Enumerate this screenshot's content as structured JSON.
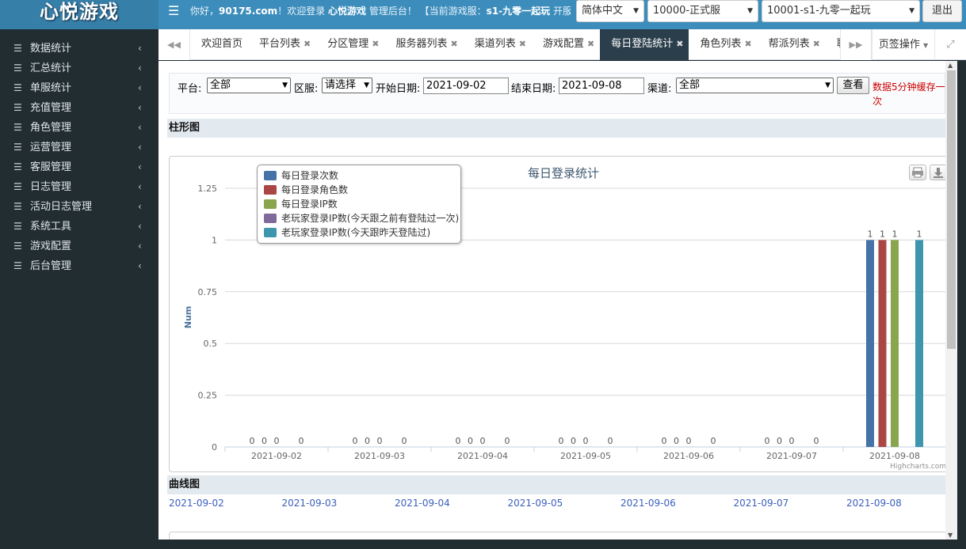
{
  "header": {
    "logo": "心悦游戏",
    "welcome_prefix": "你好，",
    "welcome_site": "90175.com",
    "welcome_middle": "！欢迎登录 ",
    "welcome_brand": "心悦游戏",
    "welcome_suffix": " 管理后台！ 【当前游戏服：",
    "current_server": "s1-九零一起玩",
    "welcome_tail": " 开服时间",
    "language": "简体中文",
    "server_group": "10000-正式服",
    "game_server": "10001-s1-九零一起玩",
    "logout": "退出"
  },
  "sidebar": {
    "items": [
      {
        "label": "数据统计",
        "icon": "menu-lines-icon"
      },
      {
        "label": "汇总统计",
        "icon": "menu-lines-icon"
      },
      {
        "label": "单服统计",
        "icon": "menu-lines-icon"
      },
      {
        "label": "充值管理",
        "icon": "menu-lines-icon"
      },
      {
        "label": "角色管理",
        "icon": "menu-lines-icon"
      },
      {
        "label": "运营管理",
        "icon": "menu-lines-icon"
      },
      {
        "label": "客服管理",
        "icon": "menu-lines-icon"
      },
      {
        "label": "日志管理",
        "icon": "menu-lines-icon"
      },
      {
        "label": "活动日志管理",
        "icon": "menu-lines-icon"
      },
      {
        "label": "系统工具",
        "icon": "menu-lines-icon"
      },
      {
        "label": "游戏配置",
        "icon": "menu-lines-icon"
      },
      {
        "label": "后台管理",
        "icon": "menu-lines-icon"
      }
    ]
  },
  "tabs": {
    "items": [
      {
        "label": "欢迎首页",
        "closable": false,
        "active": false
      },
      {
        "label": "平台列表",
        "closable": true,
        "active": false
      },
      {
        "label": "分区管理",
        "closable": true,
        "active": false
      },
      {
        "label": "服务器列表",
        "closable": true,
        "active": false
      },
      {
        "label": "渠道列表",
        "closable": true,
        "active": false
      },
      {
        "label": "游戏配置",
        "closable": true,
        "active": false
      },
      {
        "label": "每日登陆统计",
        "closable": true,
        "active": true
      },
      {
        "label": "角色列表",
        "closable": true,
        "active": false
      },
      {
        "label": "帮派列表",
        "closable": true,
        "active": false
      },
      {
        "label": "聊天",
        "closable": false,
        "active": false
      }
    ],
    "operations": "页签操作"
  },
  "filters": {
    "platform_label": "平台:",
    "platform_value": "全部",
    "zone_label": "区服:",
    "zone_value": "请选择",
    "start_label": "开始日期:",
    "start_value": "2021-09-02",
    "end_label": "结束日期:",
    "end_value": "2021-09-08",
    "channel_label": "渠道:",
    "channel_value": "全部",
    "query": "查看",
    "cache_note": "数据5分钟缓存一次"
  },
  "sections": {
    "bar": "柱形图",
    "line": "曲线图"
  },
  "chart_data": {
    "type": "bar",
    "title": "每日登录统计",
    "ylabel": "Num",
    "xlabel": "",
    "ylim": [
      0,
      1.25
    ],
    "yticks": [
      0,
      0.25,
      0.5,
      0.75,
      1,
      1.25
    ],
    "credits": "Highcharts.com",
    "legend_position": "top-left",
    "categories": [
      "2021-09-02",
      "2021-09-03",
      "2021-09-04",
      "2021-09-05",
      "2021-09-06",
      "2021-09-07",
      "2021-09-08"
    ],
    "series": [
      {
        "name": "每日登录次数",
        "color": "#4572a7",
        "values": [
          0,
          0,
          0,
          0,
          0,
          0,
          1
        ]
      },
      {
        "name": "每日登录角色数",
        "color": "#aa4643",
        "values": [
          0,
          0,
          0,
          0,
          0,
          0,
          1
        ]
      },
      {
        "name": "每日登录IP数",
        "color": "#89a54e",
        "values": [
          0,
          0,
          0,
          0,
          0,
          0,
          1
        ]
      },
      {
        "name": "老玩家登录IP数(今天跟之前有登陆过一次)",
        "color": "#80699b",
        "values": [
          null,
          null,
          null,
          null,
          null,
          null,
          null
        ]
      },
      {
        "name": "老玩家登录IP数(今天跟昨天登陆过)",
        "color": "#3d96ae",
        "values": [
          0,
          0,
          0,
          0,
          0,
          0,
          1
        ]
      }
    ]
  },
  "line_chart": {
    "dates": [
      "2021-09-02",
      "2021-09-03",
      "2021-09-04",
      "2021-09-05",
      "2021-09-06",
      "2021-09-07",
      "2021-09-08"
    ]
  }
}
